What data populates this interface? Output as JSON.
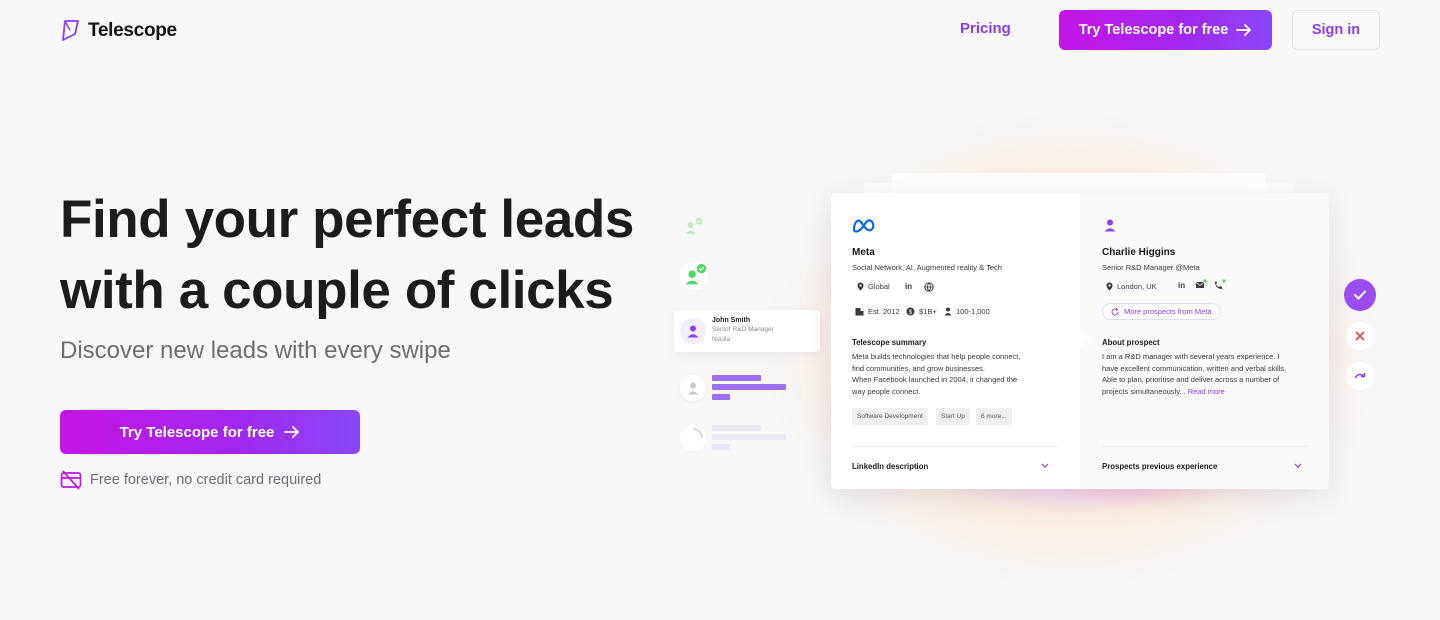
{
  "header": {
    "brand": "Telescope",
    "nav_pricing": "Pricing",
    "cta_label": "Try Telescope for free",
    "signin_label": "Sign in"
  },
  "hero": {
    "title_line1": "Find your perfect leads",
    "title_line2": "with a couple of clicks",
    "subtitle": "Discover new leads with every swipe",
    "cta_label": "Try Telescope for free",
    "free_note": "Free forever, no credit card required"
  },
  "colors": {
    "accent": "#8b3df0",
    "cta_gradient_start": "#c414e6",
    "cta_gradient_end": "#8a48fa",
    "approve_green": "#4cd964",
    "reject_red": "#e5484d"
  },
  "illustration": {
    "mini_card": {
      "name": "John Smith",
      "role": "Senior R&D Manager",
      "company": "Nvidia"
    },
    "company": {
      "name": "Meta",
      "description": "Social Network, AI, Augmented reality & Tech",
      "location": "Global",
      "founded": "Est. 2012",
      "revenue": "$1B+",
      "employees": "100-1,000",
      "summary_heading": "Telescope summary",
      "summary_lines": [
        "Meta builds technologies that help people connect,",
        "find communities, and grow businesses.",
        "When Facebook launched in 2004, it changed the",
        "way people connect."
      ],
      "tags": [
        "Software Development",
        "Start Up",
        "6 more..."
      ],
      "accordion_label": "LinkedIn description"
    },
    "prospect": {
      "name": "Charlie Higgins",
      "title": "Senior R&D Manager @Meta",
      "location": "London, UK",
      "more_label": "More prospects from Meta",
      "about_heading": "About prospect",
      "about_lines": [
        "I am a R&D manager with several years experience. I",
        "have excellent communication, written and verbal skills.",
        "Able to plan, prioritise and deliver across a number of",
        "projects simultaneously..."
      ],
      "read_more": "Read more",
      "accordion_label": "Prospects previous experience"
    }
  }
}
